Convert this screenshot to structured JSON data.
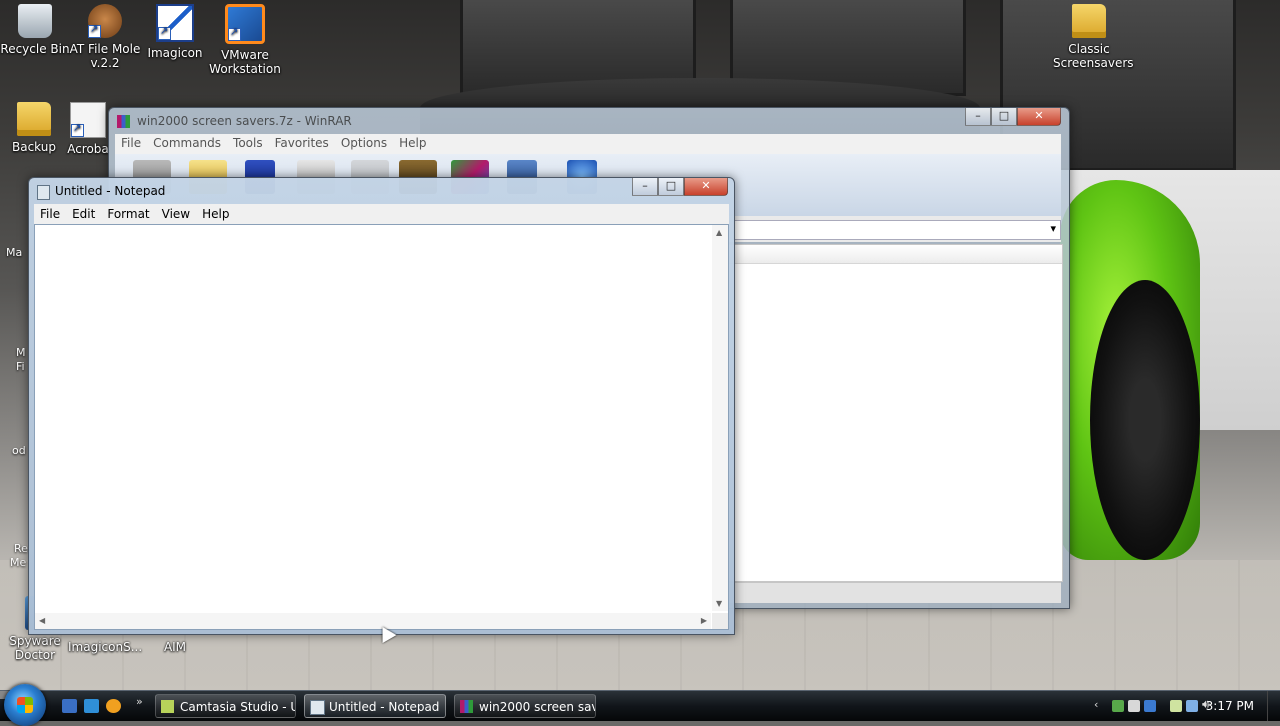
{
  "desktop": {
    "icons": [
      {
        "label": "Recycle Bin",
        "icon": "recycle-bin-icon"
      },
      {
        "label": "AT File Mole v.2.2",
        "icon": "mole-icon"
      },
      {
        "label": "Imagicon",
        "icon": "imagicon-icon"
      },
      {
        "label": "VMware Workstation",
        "icon": "vmware-icon"
      },
      {
        "label": "Classic Screensavers",
        "icon": "folder-icon"
      },
      {
        "label": "Backup",
        "icon": "folder-icon"
      },
      {
        "label": "Acroba",
        "icon": "acrobat-icon"
      },
      {
        "label": "Spyware Doctor",
        "icon": "spyware-doctor-icon"
      },
      {
        "label": "ImagiconS...",
        "icon": "imagicon-icon"
      },
      {
        "label": "AIM",
        "icon": "aim-icon"
      }
    ],
    "edge_fragments": [
      "Ma",
      "M",
      "Fi",
      "od",
      "Re",
      "Me"
    ]
  },
  "winrar": {
    "title": "win2000 screen savers.7z - WinRAR",
    "menu": [
      "File",
      "Commands",
      "Tools",
      "Favorites",
      "Options",
      "Help"
    ]
  },
  "notepad": {
    "title": "Untitled - Notepad",
    "menu": [
      "File",
      "Edit",
      "Format",
      "View",
      "Help"
    ],
    "content": ""
  },
  "taskbar": {
    "tasks": [
      {
        "label": "Camtasia Studio - U...",
        "icon": "camtasia-icon"
      },
      {
        "label": "Untitled - Notepad",
        "icon": "notepad-icon",
        "active": true
      },
      {
        "label": "win2000 screen save...",
        "icon": "winrar-icon"
      }
    ],
    "clock": "3:17 PM"
  },
  "colors": {
    "car_green": "#6fd41c",
    "taskbar": "#11151a",
    "close_button": "#c8412c"
  }
}
